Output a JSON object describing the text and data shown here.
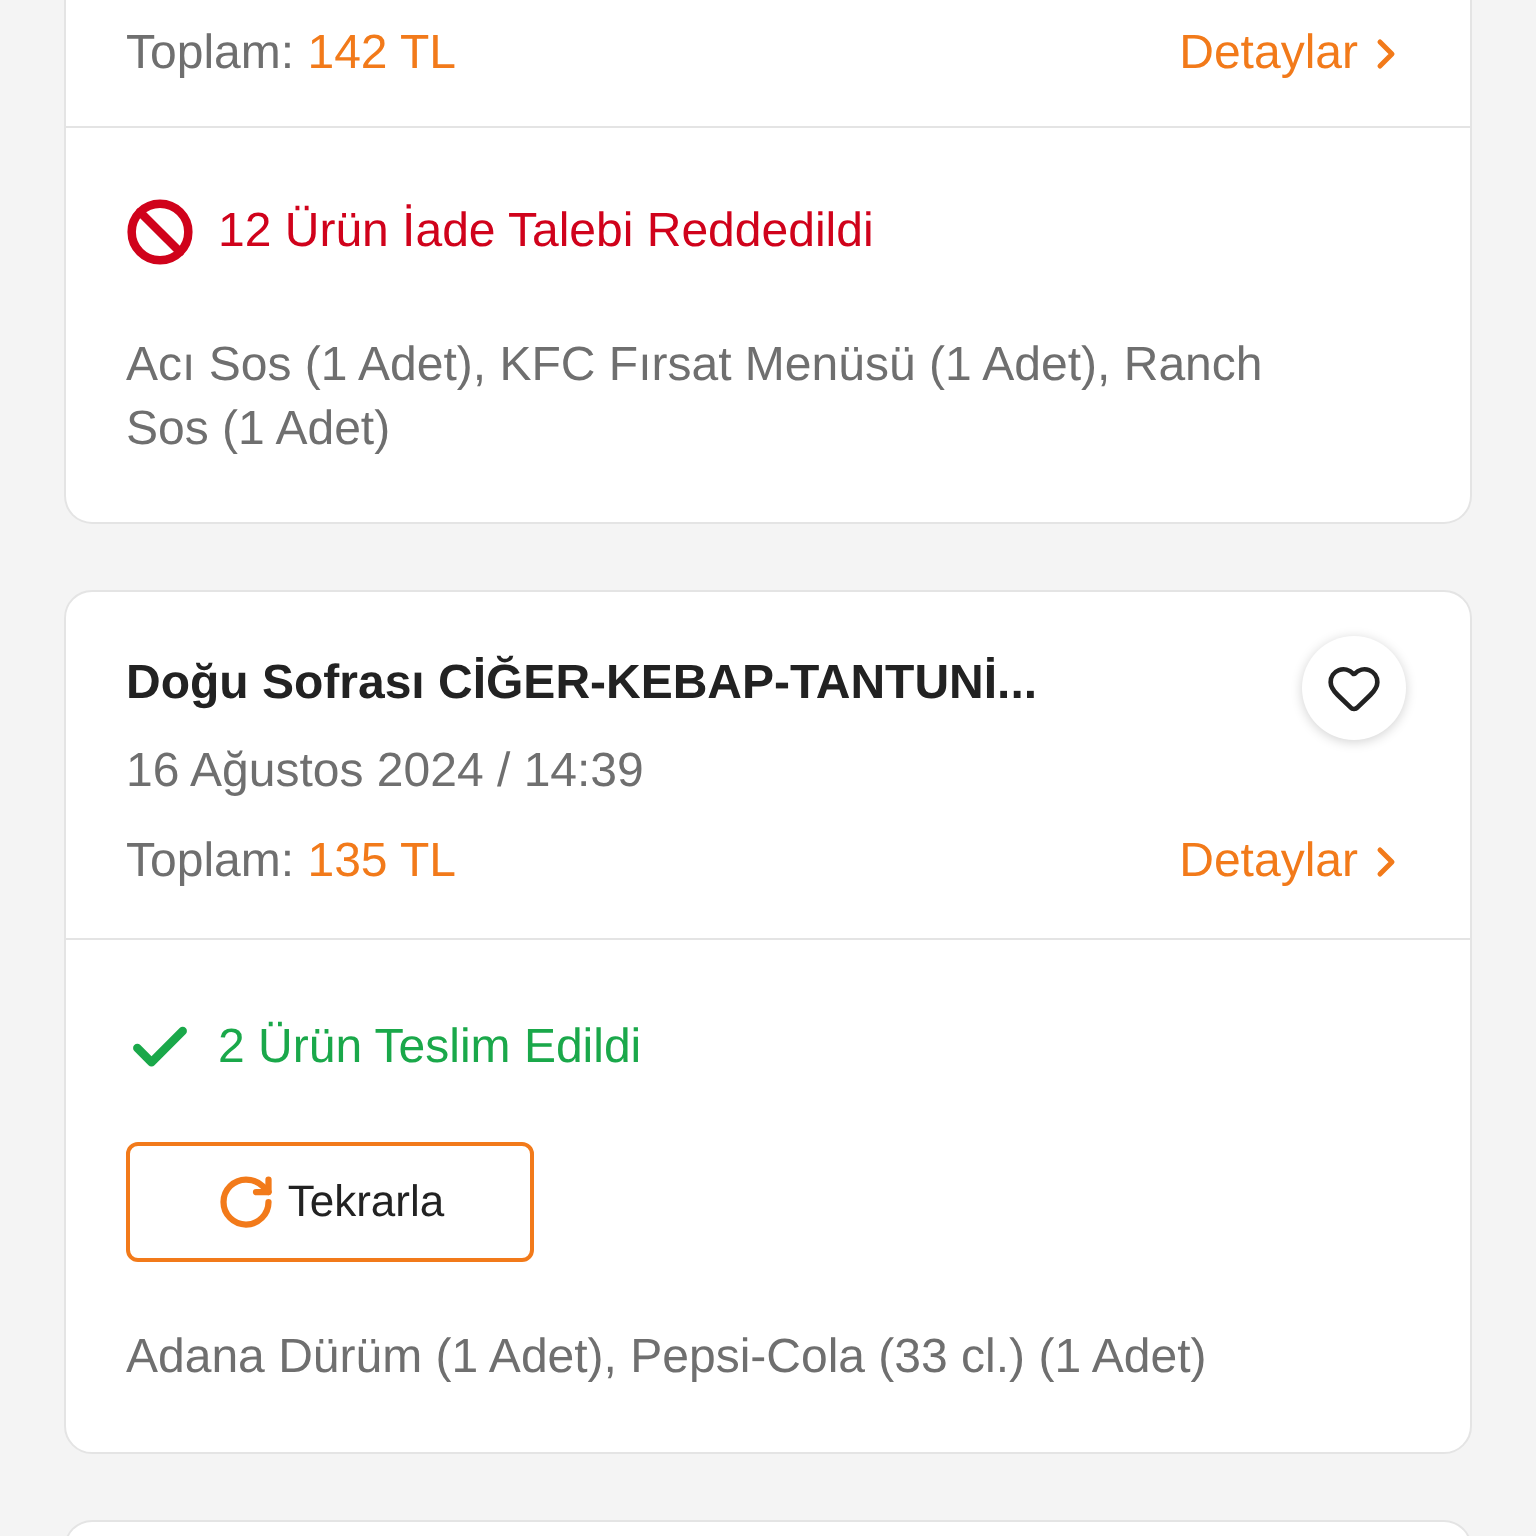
{
  "orders": [
    {
      "kind": "top_cut",
      "total_label": "Toplam:",
      "total": "142 TL",
      "details": "Detaylar",
      "status": {
        "kind": "rejected",
        "text": "12 Ürün İade Talebi Reddedildi"
      },
      "items": "Acı Sos (1 Adet), KFC Fırsat Menüsü (1 Adet), Ranch Sos (1 Adet)"
    },
    {
      "kind": "full",
      "restaurant": "Doğu Sofrası CİĞER-KEBAP-TANTUNİ...",
      "favorite": false,
      "date": "16 Ağustos 2024 / 14:39",
      "total_label": "Toplam:",
      "total": "135 TL",
      "details": "Detaylar",
      "status": {
        "kind": "delivered",
        "text": "2 Ürün Teslim Edildi"
      },
      "reorder": "Tekrarla",
      "items": "Adana Dürüm (1 Adet), Pepsi-Cola (33 cl.) (1 Adet)"
    },
    {
      "kind": "bottom_cut"
    }
  ]
}
